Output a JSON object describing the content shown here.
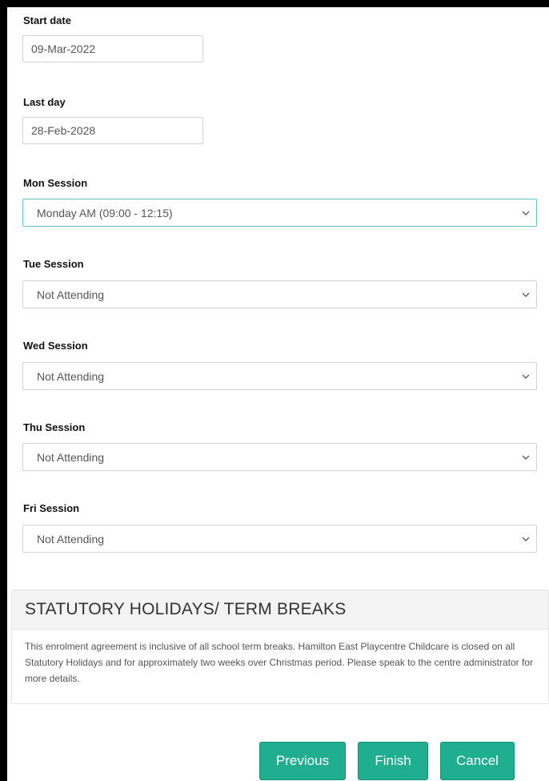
{
  "form": {
    "start_date": {
      "label": "Start date",
      "value": "09-Mar-2022"
    },
    "last_day": {
      "label": "Last day",
      "value": "28-Feb-2028"
    },
    "sessions": [
      {
        "label": "Mon Session",
        "value": "Monday AM (09:00 - 12:15)"
      },
      {
        "label": "Tue Session",
        "value": "Not Attending"
      },
      {
        "label": "Wed Session",
        "value": "Not Attending"
      },
      {
        "label": "Thu Session",
        "value": "Not Attending"
      },
      {
        "label": "Fri Session",
        "value": "Not Attending"
      }
    ]
  },
  "holidays": {
    "title": "STATUTORY HOLIDAYS/ TERM BREAKS",
    "body": "This enrolment agreement is inclusive of all school term breaks. Hamilton East Playcentre Childcare is closed on all Statutory Holidays and for approximately two weeks over Christmas period. Please speak to the centre administrator for more details."
  },
  "actions": {
    "previous_label": "Previous",
    "finish_label": "Finish",
    "cancel_label": "Cancel"
  },
  "colors": {
    "button": "#1fae8f",
    "focus_border": "#66c6cc"
  },
  "icons": {
    "select_arrow": "chevron-down-icon"
  }
}
